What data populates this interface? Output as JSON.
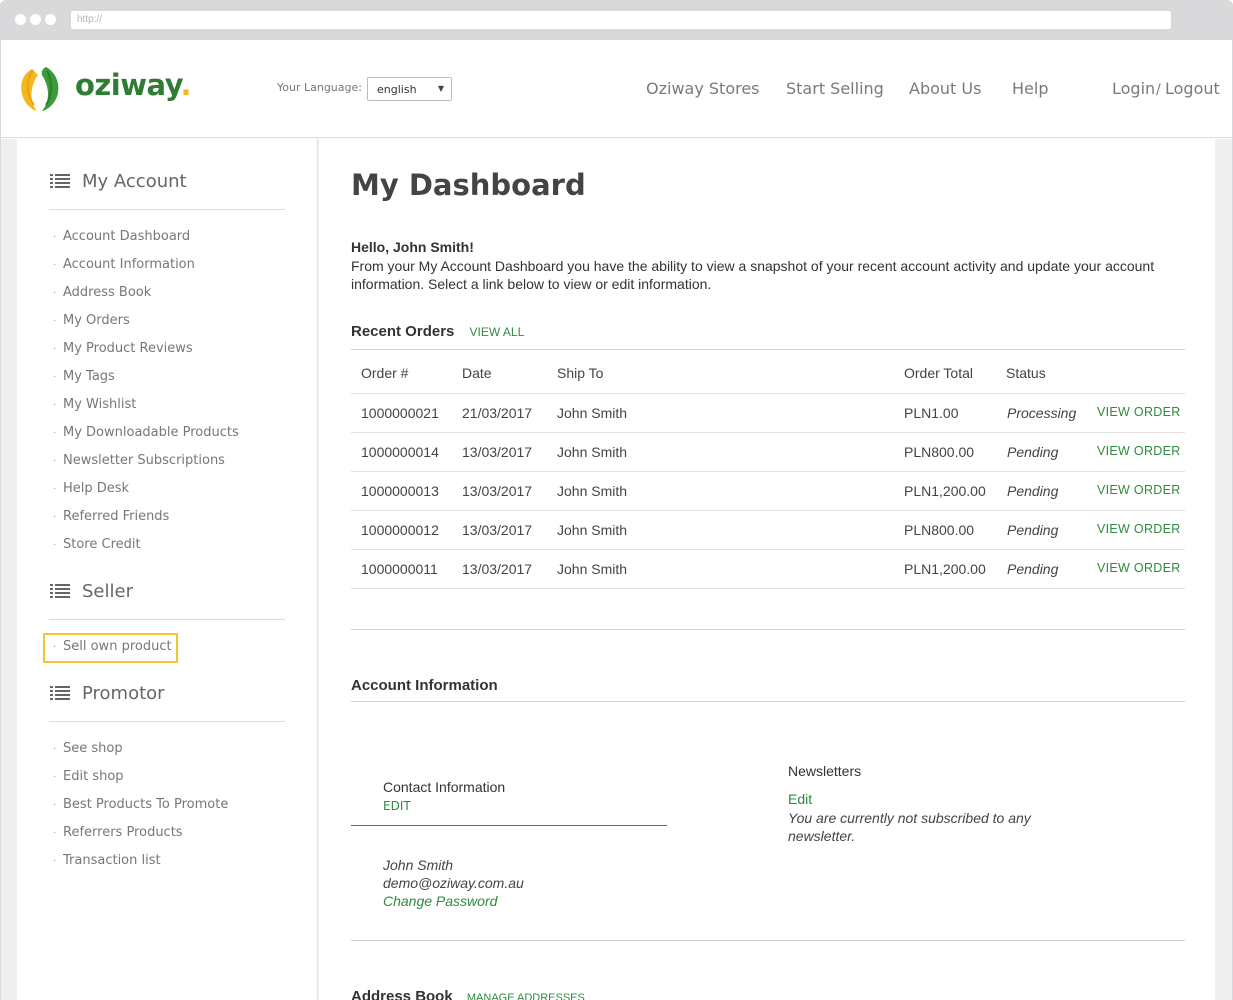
{
  "browser": {
    "url": "http://"
  },
  "header": {
    "logo_text": "oziway",
    "logo_dot": ".",
    "language_label": "Your Language:",
    "language_value": "english",
    "nav": [
      "Oziway Stores",
      "Start Selling",
      "About Us",
      "Help"
    ],
    "login": "Login",
    "separator": "/",
    "logout": "Logout"
  },
  "colors": {
    "brand_green": "#2f7d32",
    "link_green": "#2e8b3e",
    "brand_yellow": "#f5b81c",
    "highlight": "#f4c532"
  },
  "sidebar": {
    "my_account_title": "My Account",
    "my_account_items": [
      "Account Dashboard",
      "Account Information",
      "Address Book",
      "My Orders",
      "My Product Reviews",
      "My Tags",
      "My Wishlist",
      "My Downloadable Products",
      "Newsletter Subscriptions",
      "Help Desk",
      "Referred Friends",
      "Store Credit"
    ],
    "seller_title": "Seller",
    "seller_items": [
      "Sell own product"
    ],
    "promotor_title": "Promotor",
    "promotor_items": [
      "See shop",
      "Edit shop",
      "Best Products To Promote",
      "Referrers Products",
      "Transaction list"
    ]
  },
  "main": {
    "title": "My Dashboard",
    "hello": "Hello, John Smith!",
    "intro": "From your My Account Dashboard you have the ability to view a snapshot of your recent account activity and update your account information. Select a link below to view or edit information.",
    "recent_orders": {
      "title": "Recent Orders",
      "view_all": "VIEW ALL",
      "columns": [
        "Order #",
        "Date",
        "Ship To",
        "Order Total",
        "Status"
      ],
      "rows": [
        {
          "order": "1000000021",
          "date": "21/03/2017",
          "ship_to": "John Smith",
          "total": "PLN1.00",
          "status": "Processing",
          "action": "VIEW ORDER"
        },
        {
          "order": "1000000014",
          "date": "13/03/2017",
          "ship_to": "John Smith",
          "total": "PLN800.00",
          "status": "Pending",
          "action": "VIEW ORDER"
        },
        {
          "order": "1000000013",
          "date": "13/03/2017",
          "ship_to": "John Smith",
          "total": "PLN1,200.00",
          "status": "Pending",
          "action": "VIEW ORDER"
        },
        {
          "order": "1000000012",
          "date": "13/03/2017",
          "ship_to": "John Smith",
          "total": "PLN800.00",
          "status": "Pending",
          "action": "VIEW ORDER"
        },
        {
          "order": "1000000011",
          "date": "13/03/2017",
          "ship_to": "John Smith",
          "total": "PLN1,200.00",
          "status": "Pending",
          "action": "VIEW ORDER"
        }
      ]
    },
    "account_info": {
      "title": "Account Information",
      "contact_title": "Contact Information",
      "contact_edit": "EDIT",
      "name": "John Smith",
      "email": "demo@oziway.com.au",
      "change_password": "Change Password",
      "newsletters_title": "Newsletters",
      "newsletters_edit": "Edit",
      "newsletters_text": "You are currently not subscribed to any newsletter."
    },
    "address_book": {
      "title": "Address Book",
      "manage": "MANAGE ADDRESSES"
    }
  }
}
